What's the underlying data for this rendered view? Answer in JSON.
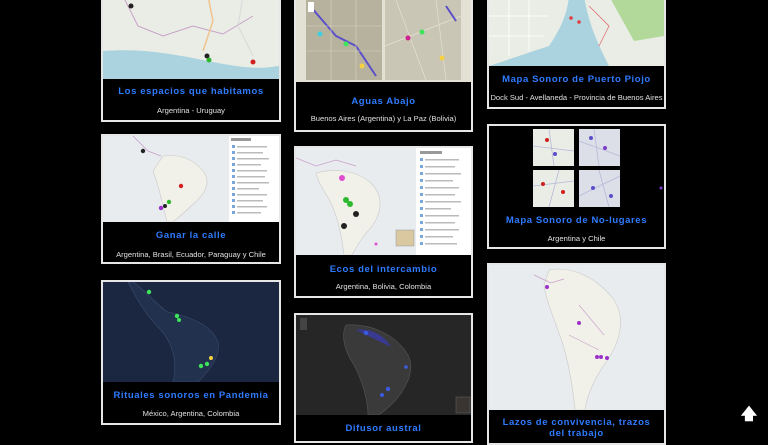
{
  "cards": [
    {
      "title": "Los espacios que habitamos",
      "subtitle": "Argentina - Uruguay"
    },
    {
      "title": "Ganar la calle",
      "subtitle": "Argentina, Brasil, Ecuador, Paraguay y Chile"
    },
    {
      "title": "Rituales sonoros en Pandemia",
      "subtitle": "México, Argentina, Colombia"
    },
    {
      "title": "Aguas Abajo",
      "subtitle": "Buenos Aires (Argentina) y La Paz (Bolivia)"
    },
    {
      "title": "Ecos del intercambio",
      "subtitle": "Argentina, Bolivia, Colombia"
    },
    {
      "title": "Difusor austral",
      "subtitle": ""
    },
    {
      "title": "Mapa Sonoro de Puerto Piojo",
      "subtitle": "Dock Sud - Avellaneda - Provincia de Buenos Aires"
    },
    {
      "title": "Mapa Sonoro de No-lugares",
      "subtitle": "Argentina y Chile"
    },
    {
      "title": "Lazos de convivencia, trazos del trabajo",
      "subtitle": ""
    }
  ],
  "scroll_top": {
    "icon": "arrow-up-icon",
    "label": "🡅"
  },
  "colors": {
    "background": "#000000",
    "title": "#2f7bff",
    "border": "#e6e6e6",
    "map_light": "#e8ecef",
    "map_dark": "#1b2740"
  }
}
